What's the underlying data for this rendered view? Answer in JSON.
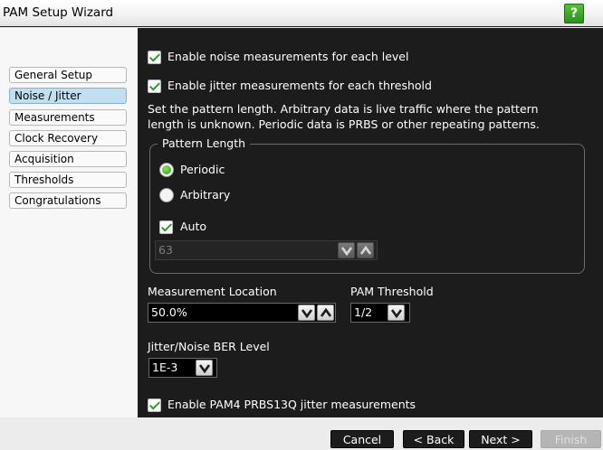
{
  "window": {
    "title": "PAM Setup Wizard",
    "help_label": "?"
  },
  "nav": {
    "items": [
      {
        "label": "General Setup"
      },
      {
        "label": "Noise / Jitter"
      },
      {
        "label": "Measurements"
      },
      {
        "label": "Clock Recovery"
      },
      {
        "label": "Acquisition"
      },
      {
        "label": "Thresholds"
      },
      {
        "label": "Congratulations"
      }
    ],
    "active": "Noise / Jitter"
  },
  "main": {
    "noise_checkbox": {
      "label": "Enable noise measurements for each level",
      "checked": true
    },
    "jitter_checkbox": {
      "label": "Enable jitter measurements for each threshold",
      "checked": true
    },
    "description_lines": [
      "Set the pattern length. Arbitrary data is live traffic where the pattern",
      "length is unknown. Periodic data is PRBS or other repeating patterns."
    ],
    "pattern_group": {
      "title": "Pattern Length",
      "periodic_label": "Periodic",
      "arbitrary_label": "Arbitrary",
      "selected": "Periodic",
      "auto_label": "Auto",
      "auto_checked": true,
      "length_value": "63"
    },
    "measurement_location": {
      "label": "Measurement Location",
      "value": "50.0%"
    },
    "pam_threshold": {
      "label": "PAM Threshold",
      "value": "1/2"
    },
    "ber_level": {
      "label": "Jitter/Noise BER Level",
      "value": "1E-3"
    },
    "prbs_checkbox": {
      "label": "Enable PAM4 PRBS13Q jitter measurements",
      "checked": true
    }
  },
  "buttons": {
    "cancel": "Cancel",
    "back": "< Back",
    "next": "Next >",
    "finish": "Finish"
  },
  "colors": {
    "accent_green": "#2e9a2c",
    "active_nav": "#c2dff1",
    "panel_bg": "#1c1c1c"
  }
}
